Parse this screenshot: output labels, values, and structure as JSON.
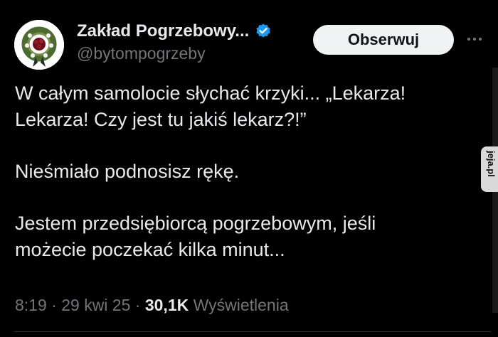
{
  "author": {
    "display_name": "Zakład Pogrzebowy...",
    "handle": "@bytompogrzeby",
    "verified_icon": "verified-badge",
    "avatar_icon": "funeral-wreath"
  },
  "actions": {
    "follow_label": "Obserwuj",
    "more_icon": "more-horizontal"
  },
  "tweet": {
    "line1": "W całym samolocie słychać krzyki... „Lekarza!",
    "line2": "Lekarza! Czy jest tu jakiś lekarz?!”",
    "line3": "Nieśmiało podnosisz rękę.",
    "line4": "Jestem przedsiębiorcą pogrzebowym, jeśli",
    "line5": "możecie poczekać kilka minut..."
  },
  "meta": {
    "time": "8:19",
    "separator": " · ",
    "date": "29 kwi 25",
    "views_count": "30,1K",
    "views_label": "Wyświetlenia"
  },
  "watermark": {
    "text": "jeja.pl"
  },
  "colors": {
    "background": "#000000",
    "text": "#e7e9ea",
    "secondary_text": "#71767b",
    "verified": "#1d9bf0",
    "button_bg": "#eff3f4"
  }
}
